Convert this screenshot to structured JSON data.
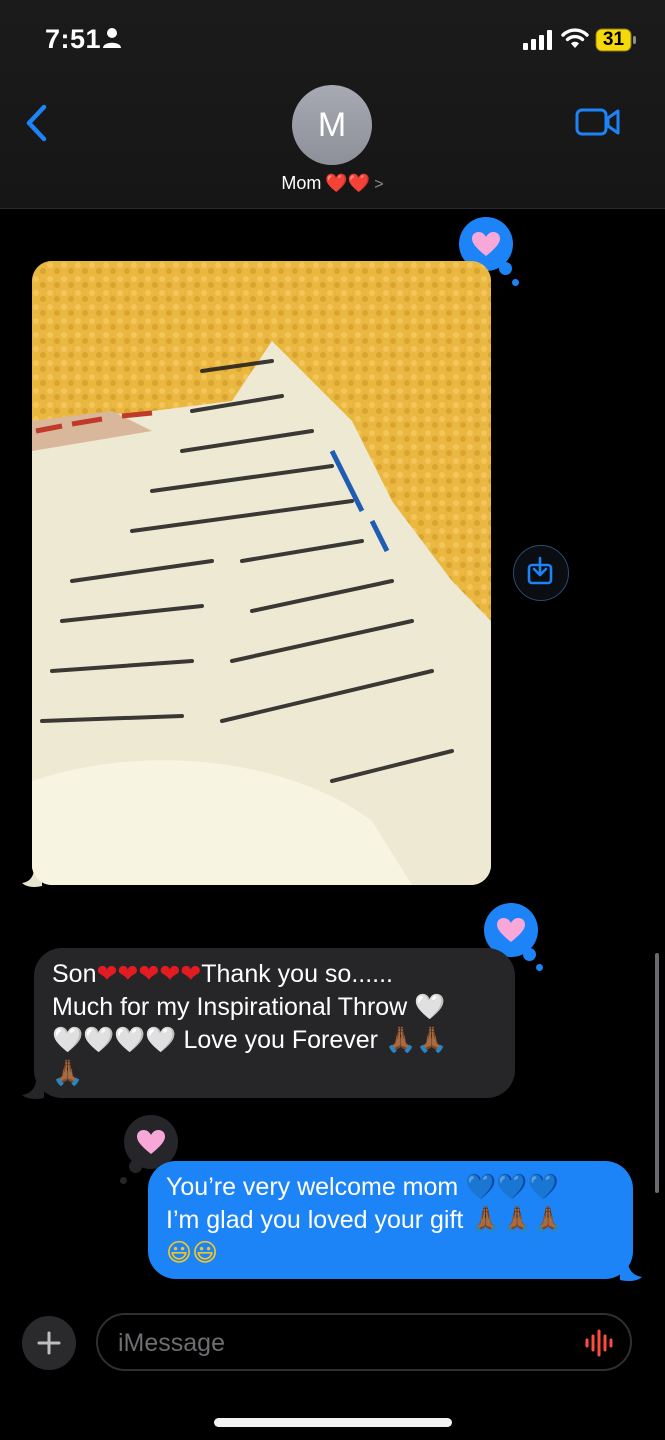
{
  "status_bar": {
    "time": "7:51",
    "battery": "31"
  },
  "header": {
    "avatar_initial": "M",
    "contact_name": "Mom",
    "contact_hearts": "❤️❤️",
    "chevron": ">"
  },
  "messages": {
    "incoming": {
      "line1_prefix": "Son",
      "line1_hearts": "❤❤❤❤❤",
      "line1_suffix": "Thank you so......",
      "line2": "Much for my Inspirational Throw",
      "line2_heart": "🤍",
      "line3_hearts": "🤍🤍🤍🤍",
      "line3_text": "Love you Forever",
      "line3_pray": "🙏🏾🙏🏾",
      "line4_pray": "🙏🏾"
    },
    "outgoing": {
      "line1_text": "You’re very welcome mom",
      "line1_hearts": "💙💙💙",
      "line2_text": "I’m glad you loved your gift",
      "line2_pray": "🙏🏾🙏🏾🙏🏾",
      "line3_smiles": "😃😃"
    }
  },
  "tapbacks": {
    "icon": "pink-heart-icon"
  },
  "compose": {
    "placeholder": "iMessage"
  },
  "colors": {
    "bubble_out": "#1c84f7",
    "bubble_in": "#262628",
    "accent": "#1c84f7",
    "heart_red": "#e31b23"
  }
}
